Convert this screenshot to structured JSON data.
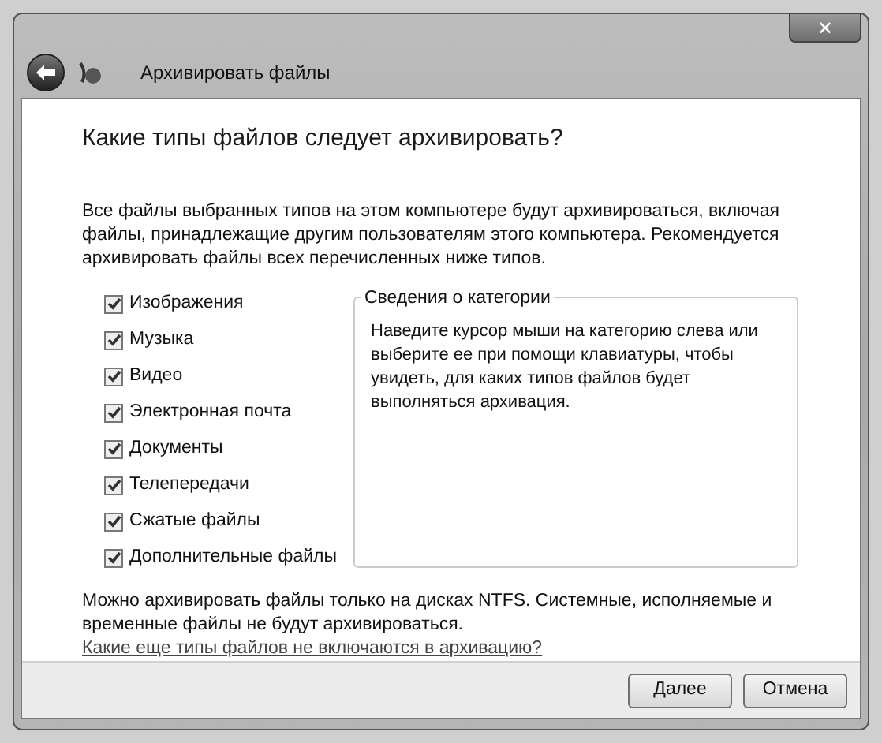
{
  "window": {
    "title": "Архивировать файлы",
    "close_button": "✕"
  },
  "heading": "Какие типы файлов следует архивировать?",
  "intro": "Все файлы выбранных типов на этом компьютере будут архивироваться, включая файлы, принадлежащие другим пользователям этого компьютера. Рекомендуется архивировать файлы всех перечисленных ниже типов.",
  "categories": [
    {
      "label": "Изображения",
      "checked": true
    },
    {
      "label": "Музыка",
      "checked": true
    },
    {
      "label": "Видео",
      "checked": true
    },
    {
      "label": "Электронная почта",
      "checked": true
    },
    {
      "label": "Документы",
      "checked": true
    },
    {
      "label": "Телепередачи",
      "checked": true
    },
    {
      "label": "Сжатые файлы",
      "checked": true
    },
    {
      "label": "Дополнительные файлы",
      "checked": true
    }
  ],
  "category_info": {
    "title": "Сведения о категории",
    "text": "Наведите курсор мыши на категорию слева или выберите ее при помощи клавиатуры, чтобы увидеть, для каких типов файлов будет выполняться архивация."
  },
  "note": {
    "text": "Можно архивировать файлы только на дисках NTFS. Системные, исполняемые и временные файлы не будут архивироваться.",
    "link": "Какие еще типы файлов не включаются в архивацию?"
  },
  "buttons": [
    "Далее",
    "Отмена"
  ]
}
